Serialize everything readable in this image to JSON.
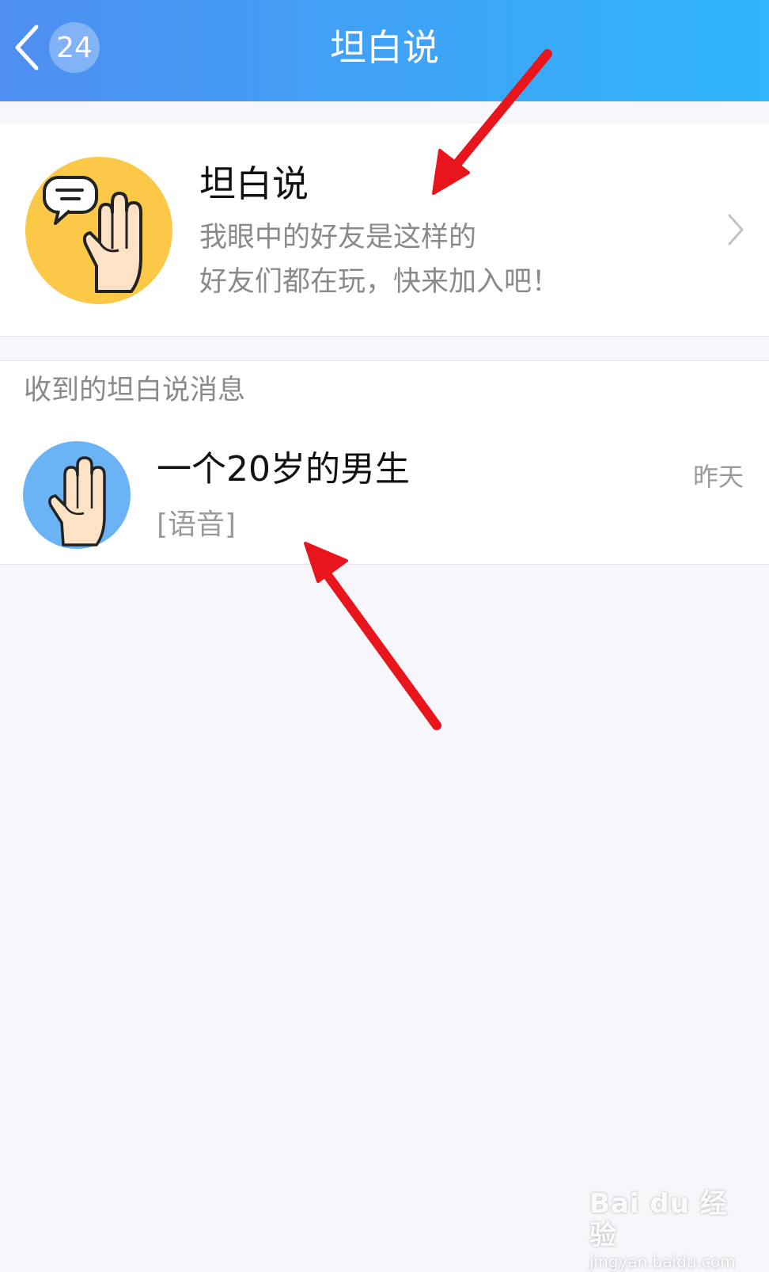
{
  "nav": {
    "title": "坦白说",
    "back_badge": "24"
  },
  "feature": {
    "title": "坦白说",
    "desc_line1": "我眼中的好友是这样的",
    "desc_line2": "好友们都在玩，快来加入吧！",
    "avatar_color": "#fbc947"
  },
  "section": {
    "title": "收到的坦白说消息"
  },
  "message": {
    "name": "一个20岁的男生",
    "preview": "[语音]",
    "time": "昨天",
    "avatar_color": "#6ab4f5"
  },
  "watermark": {
    "logo": "Bai du 经验",
    "url": "jingyan.baidu.com"
  },
  "colors": {
    "nav_start": "#4f8ef2",
    "nav_end": "#30b6fb",
    "annotation_arrow": "#e8151d"
  }
}
